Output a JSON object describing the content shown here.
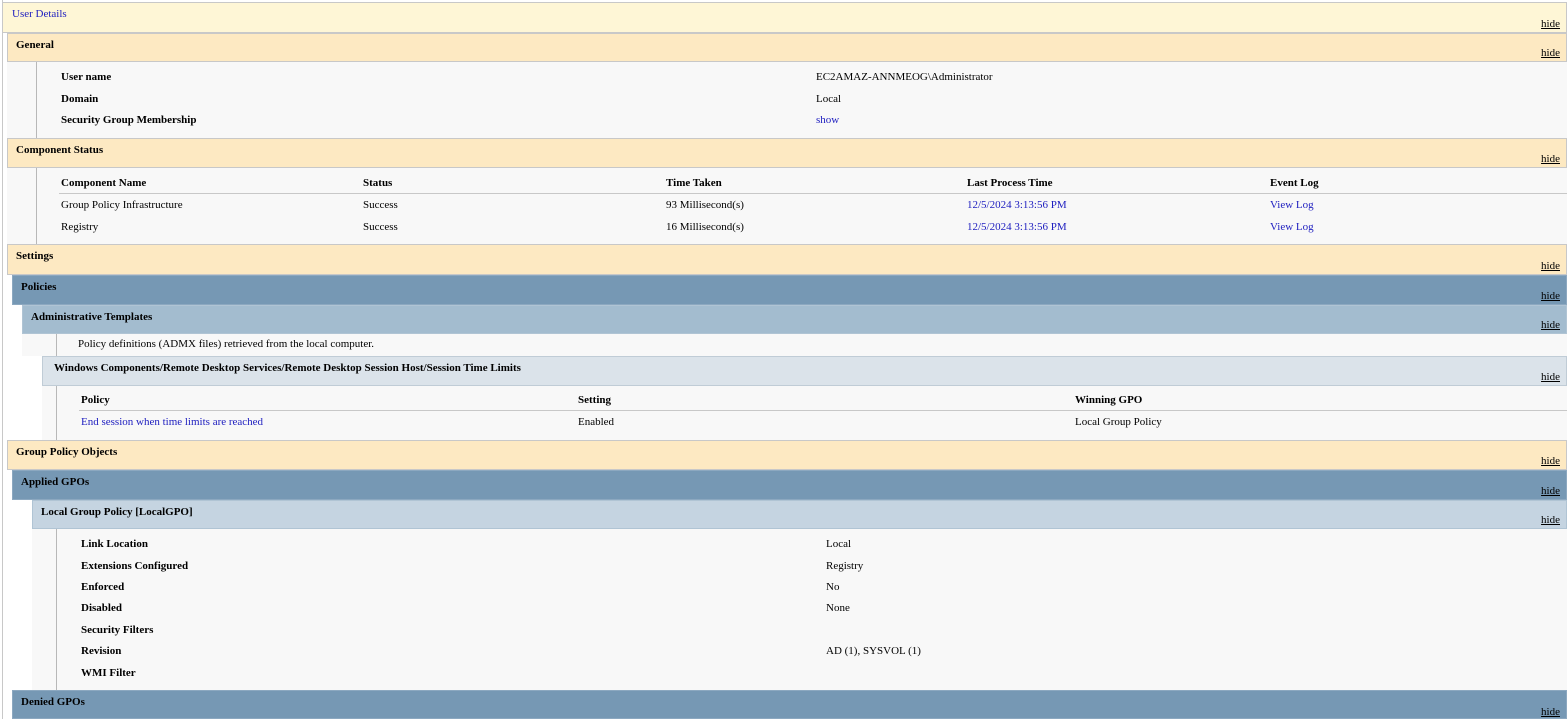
{
  "hide_label": "hide",
  "user_details": {
    "title": "User Details"
  },
  "general": {
    "title": "General",
    "rows": [
      {
        "label": "User name",
        "value": "EC2AMAZ-ANNMEOG\\Administrator"
      },
      {
        "label": "Domain",
        "value": "Local"
      },
      {
        "label": "Security Group Membership",
        "value": "show"
      }
    ]
  },
  "component_status": {
    "title": "Component Status",
    "headers": [
      "Component Name",
      "Status",
      "Time Taken",
      "Last Process Time",
      "Event Log"
    ],
    "rows": [
      {
        "name": "Group Policy Infrastructure",
        "status": "Success",
        "time": "93 Millisecond(s)",
        "last": "12/5/2024 3:13:56 PM",
        "log": "View Log"
      },
      {
        "name": "Registry",
        "status": "Success",
        "time": "16 Millisecond(s)",
        "last": "12/5/2024 3:13:56 PM",
        "log": "View Log"
      }
    ]
  },
  "settings": {
    "title": "Settings",
    "policies": {
      "title": "Policies",
      "admin_templates": {
        "title": "Administrative Templates",
        "note": "Policy definitions (ADMX files) retrieved from the local computer.",
        "category": {
          "title": "Windows Components/Remote Desktop Services/Remote Desktop Session Host/Session Time Limits",
          "headers": [
            "Policy",
            "Setting",
            "Winning GPO"
          ],
          "rows": [
            {
              "policy": "End session when time limits are reached",
              "setting": "Enabled",
              "gpo": "Local Group Policy"
            }
          ]
        }
      }
    }
  },
  "gpo": {
    "title": "Group Policy Objects",
    "applied": {
      "title": "Applied GPOs",
      "local": {
        "title": "Local Group Policy [LocalGPO]",
        "rows": [
          {
            "label": "Link Location",
            "value": "Local"
          },
          {
            "label": "Extensions Configured",
            "value": "Registry"
          },
          {
            "label": "Enforced",
            "value": "No"
          },
          {
            "label": "Disabled",
            "value": "None"
          },
          {
            "label": "Security Filters",
            "value": ""
          },
          {
            "label": "Revision",
            "value": "AD (1), SYSVOL (1)"
          },
          {
            "label": "WMI Filter",
            "value": ""
          }
        ]
      }
    },
    "denied": {
      "title": "Denied GPOs"
    }
  }
}
